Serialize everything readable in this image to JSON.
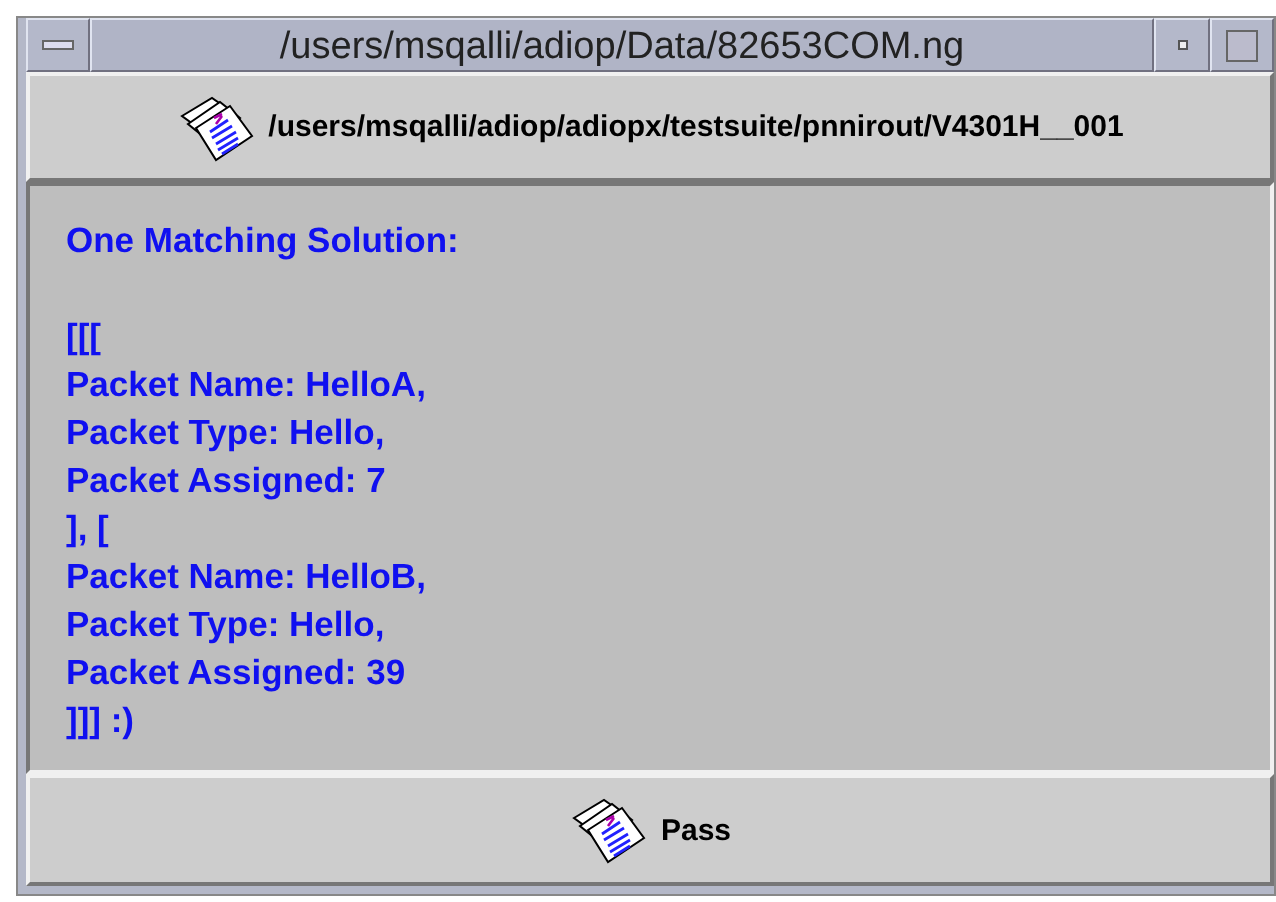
{
  "window": {
    "title": "/users/msqalli/adiop/Data/82653COM.ng"
  },
  "header": {
    "label": "/users/msqalli/adiop/adiopx/testsuite/pnnirout/V4301H__001"
  },
  "result": {
    "heading": "One Matching Solution:",
    "lines": [
      "[[[",
      "Packet Name: HelloA,",
      "Packet Type: Hello,",
      "Packet Assigned: 7",
      "], [",
      "Packet Name: HelloB,",
      "Packet Type: Hello,",
      "Packet Assigned: 39",
      "]]] :)"
    ]
  },
  "footer": {
    "label": "Pass"
  }
}
